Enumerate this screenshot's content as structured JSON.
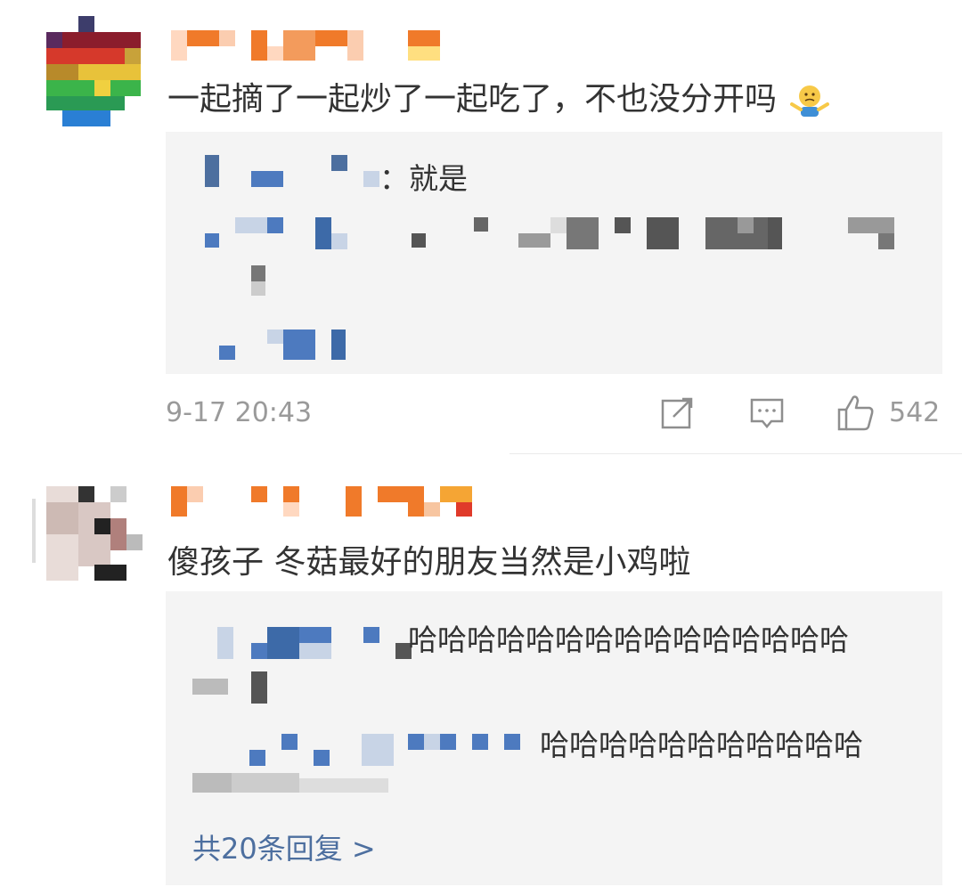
{
  "comments": [
    {
      "text": "一起摘了一起炒了一起吃了，不也没分开吗",
      "emoji": "shrug-emoji",
      "replies": [
        {
          "text": "：就是"
        }
      ],
      "timestamp": "9-17 20:43",
      "likes": "542"
    },
    {
      "text": "傻孩子 冬菇最好的朋友当然是小鸡啦",
      "replies": [
        {
          "text": "哈哈哈哈哈哈哈哈哈哈哈哈哈哈哈"
        },
        {
          "text": "哈哈哈哈哈哈哈哈哈哈哈"
        }
      ],
      "more_replies": "共20条回复 >"
    }
  ],
  "colors": {
    "reply_bg": "#f4f4f4",
    "link_blue": "#4d6f9f",
    "meta_gray": "#9a9a9a",
    "username_orange": "#f07a2a"
  }
}
